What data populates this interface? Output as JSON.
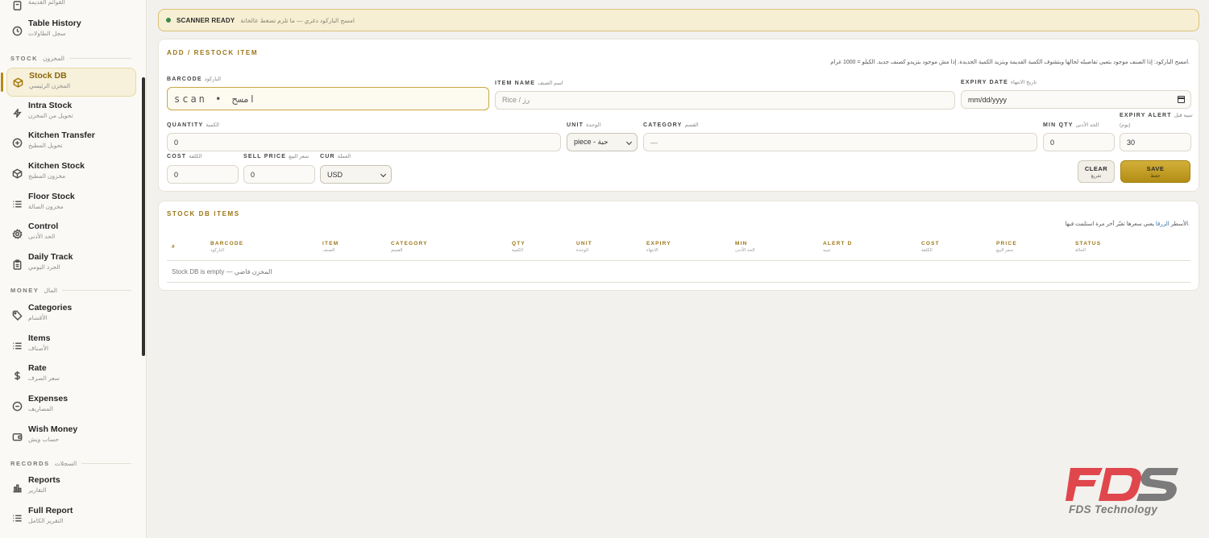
{
  "sidebar": {
    "top_partial": {
      "label": "",
      "sub": "القوائم القديمة"
    },
    "items": [
      {
        "label": "Table History",
        "sub": "سجل الطاولات",
        "icon": "clock-icon"
      },
      {
        "label": "Stock DB",
        "sub": "المخزن الرئيسي",
        "icon": "box-icon",
        "active": true
      },
      {
        "label": "Intra Stock",
        "sub": "تحويل من المخزن",
        "icon": "bolt-icon"
      },
      {
        "label": "Kitchen Transfer",
        "sub": "تحويل المطبخ",
        "icon": "plus-circle-icon"
      },
      {
        "label": "Kitchen Stock",
        "sub": "مخزون المطبخ",
        "icon": "box-icon"
      },
      {
        "label": "Floor Stock",
        "sub": "مخزون الصالة",
        "icon": "list-icon"
      },
      {
        "label": "Control",
        "sub": "الحد الأدنى",
        "icon": "gear-icon"
      },
      {
        "label": "Daily Track",
        "sub": "الجرد اليومي",
        "icon": "clipboard-icon"
      },
      {
        "label": "Categories",
        "sub": "الأقسام",
        "icon": "tag-icon"
      },
      {
        "label": "Items",
        "sub": "الأصناف",
        "icon": "list-icon"
      },
      {
        "label": "Rate",
        "sub": "سعر الصرف",
        "icon": "dollar-icon"
      },
      {
        "label": "Expenses",
        "sub": "المصاريف",
        "icon": "minus-circle-icon"
      },
      {
        "label": "Wish Money",
        "sub": "حساب ويش",
        "icon": "wallet-icon"
      },
      {
        "label": "Reports",
        "sub": "التقارير",
        "icon": "bar-chart-icon"
      },
      {
        "label": "Full Report",
        "sub": "التقرير الكامل",
        "icon": "list-icon"
      }
    ],
    "sections": [
      {
        "en": "STOCK",
        "ar": "المخزون"
      },
      {
        "en": "MONEY",
        "ar": "المال"
      },
      {
        "en": "RECORDS",
        "ar": "السجلات"
      }
    ]
  },
  "banner": {
    "title": "SCANNER READY",
    "hint": "امسح الباركود دغري — ما تلزم تضغط عالخانة",
    "status_color": "#3c8a4a"
  },
  "form": {
    "title": "ADD / RESTOCK ITEM",
    "note": "امسح الباركود: إذا الصنف موجود بتعبى تفاصيله لحالها وبتشوف الكمية القديمة وبتزيد الكمية الجديدة. إذا مش موجود بتزيدو كصنف جديد. الكيلو = 1000 غرام.",
    "barcode": {
      "label": "BARCODE",
      "ar": "الباركود",
      "placeholder": "scan  •  امسح"
    },
    "item_name": {
      "label": "ITEM NAME",
      "ar": "اسم الصنف",
      "placeholder": "Rice / رز"
    },
    "expiry_date": {
      "label": "EXPIRY DATE",
      "ar": "تاريخ الانتهاء",
      "placeholder": "mm/dd/yyyy"
    },
    "quantity": {
      "label": "QUANTITY",
      "ar": "الكمية",
      "value": "0"
    },
    "unit": {
      "label": "UNIT",
      "ar": "الوحدة",
      "value": "piece - حبة"
    },
    "category": {
      "label": "CATEGORY",
      "ar": "القسم",
      "value": "—"
    },
    "min_qty": {
      "label": "MIN QTY",
      "ar": "الحد الأدنى",
      "value": "0"
    },
    "expiry_alert": {
      "label": "EXPIRY ALERT",
      "ar": "تنبيه قبل",
      "ar2": "(يوم)",
      "value": "30"
    },
    "cost": {
      "label": "COST",
      "ar": "الكلفة",
      "value": "0"
    },
    "sell_price": {
      "label": "SELL PRICE",
      "ar": "سعر البيع",
      "value": "0"
    },
    "currency": {
      "label": "CUR",
      "ar": "العملة",
      "value": "USD"
    },
    "clear_button": {
      "label": "CLEAR",
      "sub": "تفريغ"
    },
    "save_button": {
      "label": "SAVE",
      "sub": "حفظ"
    }
  },
  "table": {
    "title": "STOCK DB ITEMS",
    "note_prefix": "الأسطر",
    "note_link": "الزرقا",
    "note_suffix": "يعني سعرها تغيّر آخر مرة استلمت فيها.",
    "columns": [
      {
        "en": "#",
        "ar": ""
      },
      {
        "en": "BARCODE",
        "ar": "الباركود"
      },
      {
        "en": "ITEM",
        "ar": "الصنف"
      },
      {
        "en": "CATEGORY",
        "ar": "القسم"
      },
      {
        "en": "QTY",
        "ar": "الكمية"
      },
      {
        "en": "UNIT",
        "ar": "الوحدة"
      },
      {
        "en": "EXPIRY",
        "ar": "الانتهاء"
      },
      {
        "en": "MIN",
        "ar": "الحد الأدنى"
      },
      {
        "en": "ALERT D",
        "ar": "تنبيه"
      },
      {
        "en": "COST",
        "ar": "الكلفة"
      },
      {
        "en": "PRICE",
        "ar": "سعر البيع"
      },
      {
        "en": "STATUS",
        "ar": "الحالة"
      }
    ],
    "empty_message": "Stock DB is empty — المخزن فاضي"
  },
  "logo": {
    "letters": "FDS",
    "caption": "FDS Technology",
    "red": "#e0474c",
    "gray": "#7b7b7b"
  }
}
